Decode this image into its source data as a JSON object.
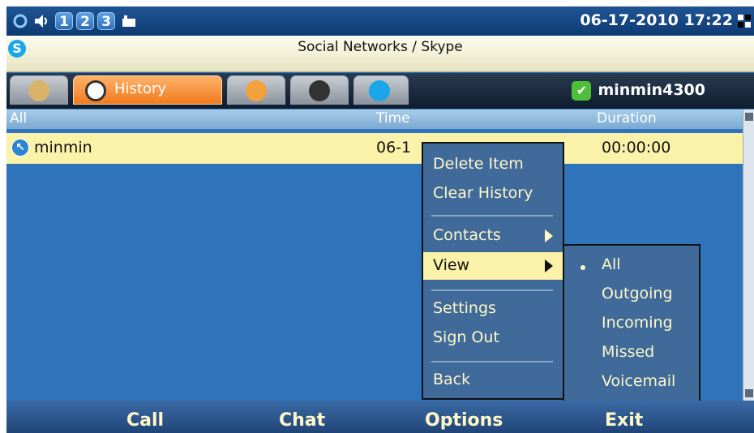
{
  "status_bar": {
    "indicators": [
      "1",
      "2",
      "3"
    ],
    "clock": "06-17-2010 17:22"
  },
  "title_bar": {
    "title": "Social Networks / Skype",
    "active_tab_label": "History",
    "username": "minmin4300"
  },
  "list": {
    "columns": [
      "All",
      "Time",
      "Duration"
    ],
    "rows": [
      {
        "name": "minmin",
        "time": "06-1",
        "duration": "00:00:00"
      }
    ]
  },
  "context_menu": {
    "items": [
      "Delete Item",
      "Clear History",
      "Contacts",
      "View",
      "Settings",
      "Sign Out",
      "Back"
    ],
    "highlighted": "View"
  },
  "view_submenu": {
    "items": [
      "All",
      "Outgoing",
      "Incoming",
      "Missed",
      "Voicemail"
    ],
    "selected": "All"
  },
  "softkeys": {
    "call": "Call",
    "chat": "Chat",
    "options": "Options",
    "exit": "Exit"
  },
  "colors": {
    "screen_bg": "#2f73b8",
    "row_highlight": "#fbf2a9",
    "menu_bg": "#3f6a9a",
    "active_tab": "#f07a1e"
  }
}
